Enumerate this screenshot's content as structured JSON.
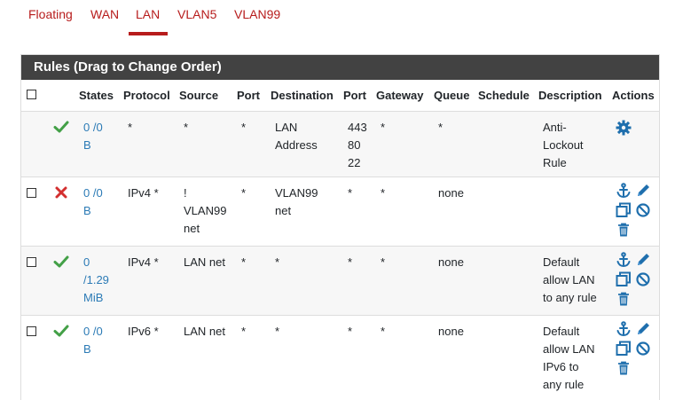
{
  "tabs": [
    {
      "label": "Floating"
    },
    {
      "label": "WAN"
    },
    {
      "label": "LAN"
    },
    {
      "label": "VLAN5"
    },
    {
      "label": "VLAN99"
    }
  ],
  "active_tab": "LAN",
  "panel": {
    "title": "Rules (Drag to Change Order)"
  },
  "columns": {
    "states": "States",
    "protocol": "Protocol",
    "source": "Source",
    "port": "Port",
    "destination": "Destination",
    "dest_port": "Port",
    "gateway": "Gateway",
    "queue": "Queue",
    "schedule": "Schedule",
    "description": "Description",
    "actions": "Actions"
  },
  "rows": [
    {
      "status": "pass",
      "states": "0 /0\nB",
      "protocol": "*",
      "source": "*",
      "port": "*",
      "destination": "LAN\nAddress",
      "dest_port": "443\n80\n22",
      "gateway": "*",
      "queue": "*",
      "schedule": "",
      "description": "Anti-\nLockout\nRule"
    },
    {
      "status": "block",
      "states": "0 /0\nB",
      "protocol": "IPv4 *",
      "source": "!\nVLAN99\nnet",
      "port": "*",
      "destination": "VLAN99\nnet",
      "dest_port": "*",
      "gateway": "*",
      "queue": "none",
      "schedule": "",
      "description": ""
    },
    {
      "status": "pass",
      "states": "0\n/1.29\nMiB",
      "protocol": "IPv4 *",
      "source": "LAN net",
      "port": "*",
      "destination": "*",
      "dest_port": "*",
      "gateway": "*",
      "queue": "none",
      "schedule": "",
      "description": "Default\nallow LAN\nto any rule"
    },
    {
      "status": "pass",
      "states": "0 /0\nB",
      "protocol": "IPv6 *",
      "source": "LAN net",
      "port": "*",
      "destination": "*",
      "dest_port": "*",
      "gateway": "*",
      "queue": "none",
      "schedule": "",
      "description": "Default\nallow LAN\nIPv6 to\nany rule"
    }
  ],
  "colors": {
    "accent": "#b71c1c",
    "panel_header": "#424242",
    "link": "#2c7bb6",
    "pass": "#43a047",
    "block": "#d32f2f",
    "icon": "#1f6fad"
  },
  "icons": {
    "pass": "check-icon",
    "block": "x-icon",
    "settings": "gear-icon",
    "anchor": "anchor-icon",
    "edit": "pencil-icon",
    "copy": "copy-icon",
    "disable": "ban-icon",
    "delete": "trash-icon"
  }
}
